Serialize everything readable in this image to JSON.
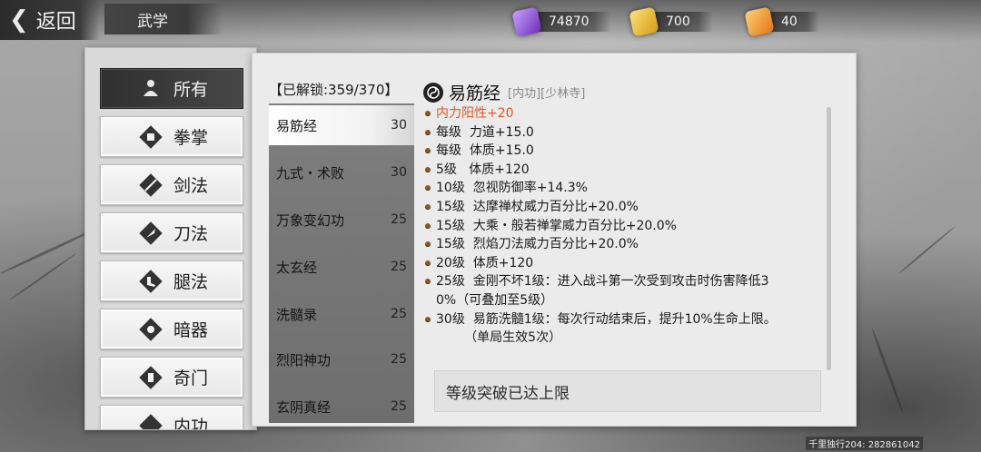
{
  "header": {
    "back_label": "返回",
    "section_title": "武学"
  },
  "currencies": [
    {
      "icon": "purple-ticket-icon",
      "value": "74870"
    },
    {
      "icon": "gold-token-icon",
      "value": "700"
    },
    {
      "icon": "orange-token-icon",
      "value": "40"
    }
  ],
  "categories": [
    {
      "label": "所有",
      "icon": "all-icon",
      "active": true
    },
    {
      "label": "拳掌",
      "icon": "fist-icon"
    },
    {
      "label": "剑法",
      "icon": "sword-icon"
    },
    {
      "label": "刀法",
      "icon": "blade-icon"
    },
    {
      "label": "腿法",
      "icon": "kick-icon"
    },
    {
      "label": "暗器",
      "icon": "shuriken-icon"
    },
    {
      "label": "奇门",
      "icon": "exotic-weapon-icon"
    },
    {
      "label": "内功",
      "icon": "inner-power-icon"
    }
  ],
  "unlock_text": "【已解锁:359/370】",
  "skills": [
    {
      "name": "易筋经",
      "level": "30",
      "active": true
    },
    {
      "name": "九式・术败",
      "level": "30"
    },
    {
      "name": "万象变幻功",
      "level": "25"
    },
    {
      "name": "太玄经",
      "level": "25"
    },
    {
      "name": "洗髓录",
      "level": "25"
    },
    {
      "name": "烈阳神功",
      "level": "25"
    },
    {
      "name": "玄阴真经",
      "level": "25"
    }
  ],
  "detail": {
    "name": "易筋经",
    "tags": "[内功][少林寺]",
    "lines": [
      {
        "text": "内力阳性+20",
        "highlight": true
      },
      {
        "text": "每级  力道+15.0"
      },
      {
        "text": "每级  体质+15.0"
      },
      {
        "text": "5级   体质+120"
      },
      {
        "text": "10级  忽视防御率+14.3%"
      },
      {
        "text": "15级  达摩禅杖威力百分比+20.0%"
      },
      {
        "text": "15级  大乘・般若禅掌威力百分比+20.0%"
      },
      {
        "text": "15级  烈焰刀法威力百分比+20.0%"
      },
      {
        "text": "20级  体质+120"
      },
      {
        "text": "25级  金刚不坏1级：进入战斗第一次受到攻击时伤害降低3"
      },
      {
        "text": "0%（可叠加至5级）",
        "continuation": true
      },
      {
        "text": "30级  易筋洗髓1级：每次行动结束后，提升10%生命上限。"
      },
      {
        "text": "       （单局生效5次）",
        "continuation": true
      }
    ],
    "max_text": "等级突破已达上限"
  },
  "watermark": "千里独行204: 282861042"
}
